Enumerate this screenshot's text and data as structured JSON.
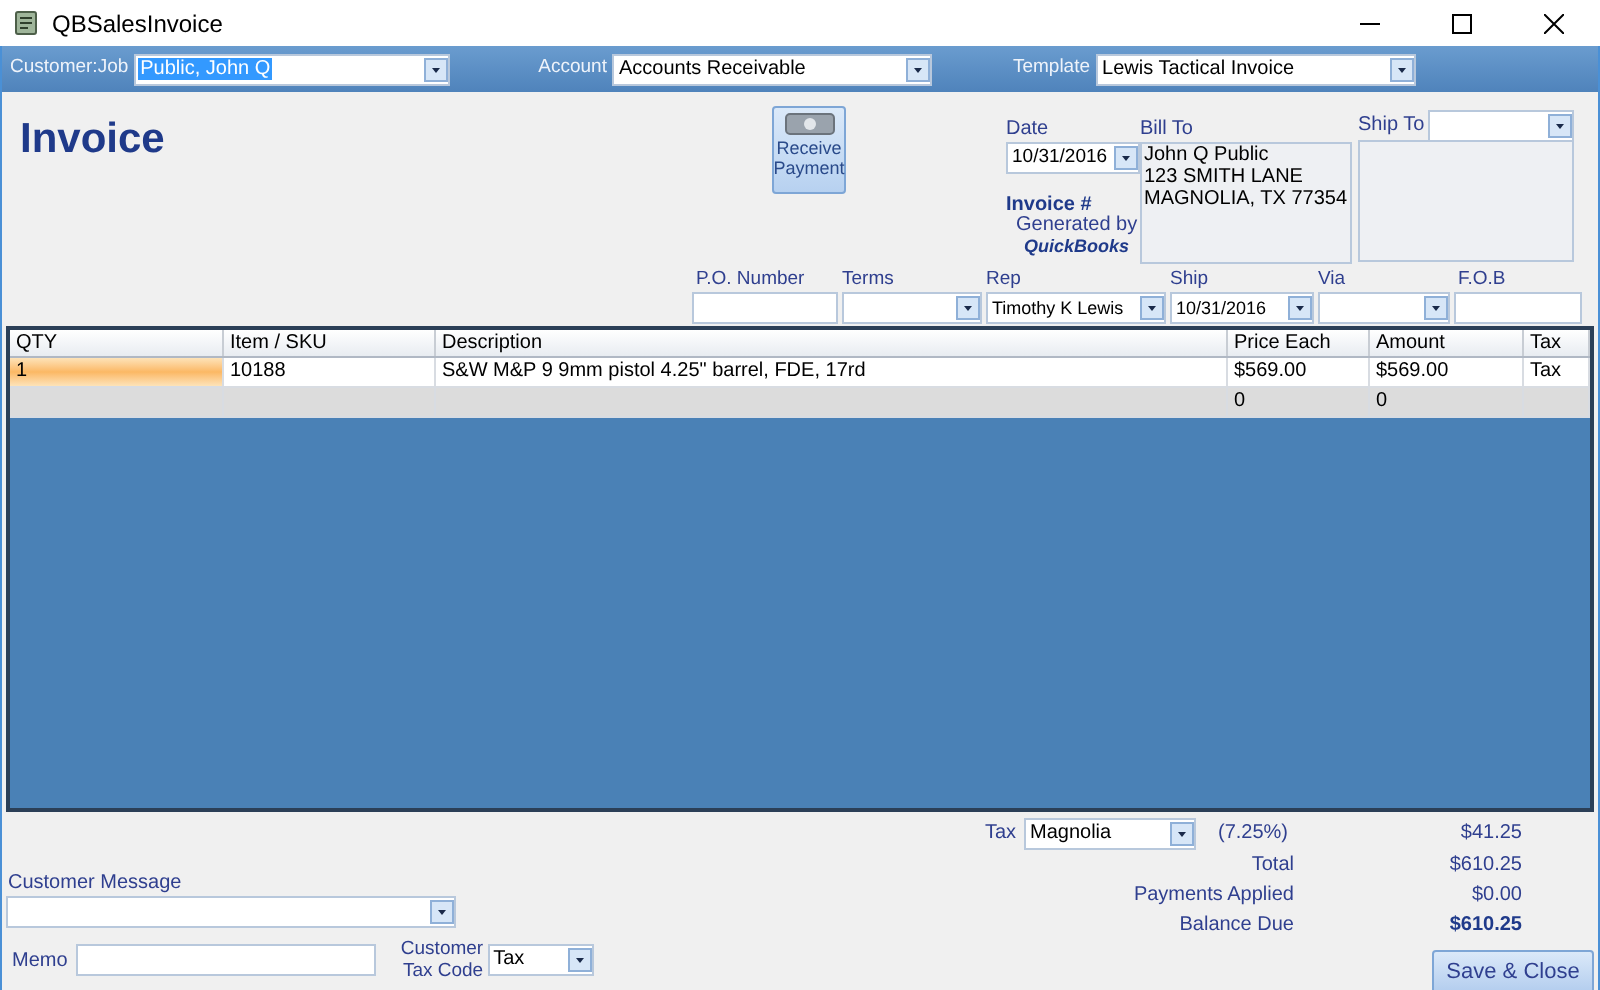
{
  "window": {
    "title": "QBSalesInvoice"
  },
  "header": [
    {
      "label": "Customer:Job",
      "value": "Public, John Q",
      "selected": true
    },
    {
      "label": "Account",
      "value": "Accounts Receivable",
      "selected": false
    },
    {
      "label": "Template",
      "value": "Lewis Tactical Invoice",
      "selected": false
    }
  ],
  "invoice": {
    "title": "Invoice",
    "receive_payment": "Receive Payment",
    "date": {
      "label": "Date",
      "value": "10/31/2016"
    },
    "invoice_number": {
      "label": "Invoice #",
      "note": "Generated by",
      "source": "QuickBooks"
    },
    "bill_to": {
      "label": "Bill To",
      "lines": [
        "John Q Public",
        "123 SMITH LANE",
        "MAGNOLIA, TX 77354"
      ]
    },
    "ship_to": {
      "label": "Ship To"
    }
  },
  "fields": [
    {
      "label": "P.O. Number",
      "kind": "text"
    },
    {
      "label": "Terms",
      "kind": "combo"
    },
    {
      "label": "Rep",
      "kind": "combo",
      "value": "Timothy K Lewis"
    },
    {
      "label": "Ship",
      "kind": "combo",
      "value": "10/31/2016"
    },
    {
      "label": "Via",
      "kind": "combo"
    },
    {
      "label": "F.O.B",
      "kind": "text"
    }
  ],
  "table": {
    "columns": [
      "QTY",
      "Item / SKU",
      "Description",
      "Price Each",
      "Amount",
      "Tax"
    ],
    "rows": [
      {
        "kind": "item",
        "focused": true,
        "qty": "1",
        "item": "10188",
        "description": "S&W M&P 9 9mm pistol 4.25\" barrel, FDE, 17rd",
        "price_each": "$569.00",
        "amount": "$569.00",
        "tax": "Tax"
      },
      {
        "kind": "new",
        "focused": false,
        "price_each": "0",
        "amount": "0"
      }
    ]
  },
  "tax": {
    "label": "Tax",
    "value": "Magnolia",
    "rate": "(7.25%)",
    "amount": "$41.25"
  },
  "totals": [
    {
      "label": "Total",
      "value": "$610.25",
      "kind": "normal"
    },
    {
      "label": "Payments Applied",
      "value": "$0.00",
      "kind": "normal"
    },
    {
      "label": "Balance Due",
      "value": "$610.25",
      "kind": "emphasis"
    }
  ],
  "customer_message": {
    "label": "Customer Message"
  },
  "memo": {
    "label": "Memo"
  },
  "customer_tax_code": {
    "label": "Customer Tax Code",
    "value": "Tax"
  },
  "buttons": [
    {
      "label": "Save & Close"
    }
  ]
}
